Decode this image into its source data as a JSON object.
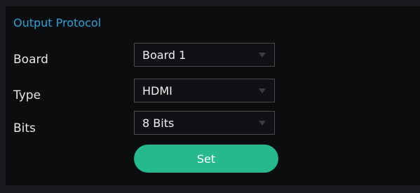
{
  "section": {
    "title": "Output Protocol"
  },
  "fields": [
    {
      "label": "Board",
      "value": "Board 1",
      "icon": "chevron-down-icon"
    },
    {
      "label": "Type",
      "value": "HDMI",
      "icon": "chevron-down-icon"
    },
    {
      "label": "Bits",
      "value": "8 Bits",
      "icon": "chevron-down-icon"
    }
  ],
  "actions": {
    "set_label": "Set"
  },
  "colors": {
    "title": "#2fa0d8",
    "button": "#26b98c",
    "panel_bg": "#0c0d0f"
  }
}
